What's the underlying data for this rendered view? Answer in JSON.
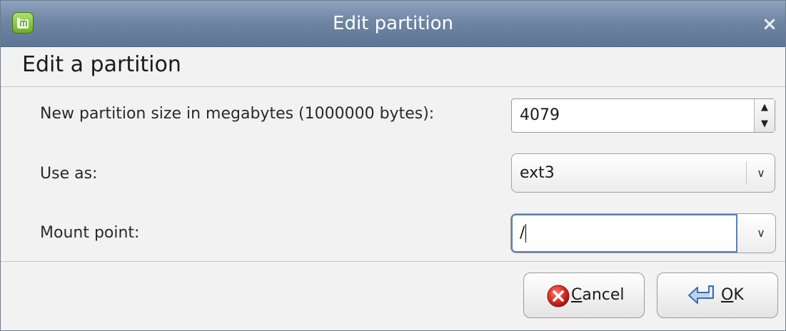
{
  "window": {
    "title": "Edit partition",
    "app_icon": "linux-mint-icon",
    "close_icon": "close-icon",
    "close_glyph": "×"
  },
  "dialog": {
    "heading": "Edit a partition"
  },
  "form": {
    "size": {
      "label": "New partition size in megabytes (1000000 bytes):",
      "value": "4079"
    },
    "use_as": {
      "label": "Use as:",
      "value": "ext3"
    },
    "mount_point": {
      "label": "Mount point:",
      "value": "/"
    }
  },
  "buttons": {
    "cancel": {
      "mnemonic": "C",
      "rest": "ancel",
      "icon": "cancel-icon"
    },
    "ok": {
      "mnemonic": "O",
      "rest": "K",
      "icon": "ok-return-icon"
    }
  },
  "colors": {
    "titlebar": "#6f86a3",
    "focus_border": "#5b7fb3",
    "cancel_red": "#d9302b"
  }
}
